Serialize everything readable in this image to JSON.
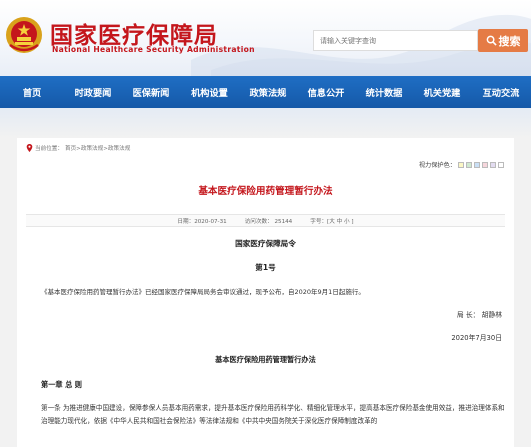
{
  "header": {
    "title_cn": "国家医疗保障局",
    "title_en": "National Healthcare Security Administration",
    "search_placeholder": "请输入关键字查询",
    "search_label": "搜索",
    "brand_color": "#c4161c",
    "search_color": "#e57b45"
  },
  "nav": {
    "items": [
      "首页",
      "时政要闻",
      "医保新闻",
      "机构设置",
      "政策法规",
      "信息公开",
      "统计数据",
      "机关党建",
      "互动交流"
    ],
    "color": "#1a63b6"
  },
  "breadcrumb": {
    "current_label": "当前位置：",
    "path": "首页>政策法规>政策法规"
  },
  "vision": {
    "label": "视力保护色：",
    "swatches": [
      "#fbf7c5",
      "#cfe8cf",
      "#c9dff5",
      "#f6d6dc",
      "#e3dcf1",
      "#ffffff"
    ]
  },
  "document": {
    "title": "基本医疗保险用药管理暂行办法",
    "date": "日期：2020-07-31",
    "views": "访问次数：  25144",
    "font_size_label": "字号：[",
    "font_large": "大",
    "font_medium": "中",
    "font_small": "小",
    "font_size_close": "]",
    "order_title": "国家医疗保障局令",
    "order_number": "第1号",
    "intro": "《基本医疗保险用药管理暂行办法》已经国家医疗保障局局务会审议通过，现予公布，自2020年9月1日起施行。",
    "signer": "局  长：  胡静林",
    "sign_date": "2020年7月30日",
    "subtitle": "基本医疗保险用药管理暂行办法",
    "chapter": "第一章    总  则",
    "article1": "第一条    为推进健康中国建设，保障参保人员基本用药需求，提升基本医疗保险用药科学化、精细化管理水平，提高基本医疗保险基金使用效益，推进治理体系和治理能力现代化，依据《中华人民共和国社会保险法》等法律法规和《中共中央国务院关于深化医疗保障制度改革的"
  }
}
